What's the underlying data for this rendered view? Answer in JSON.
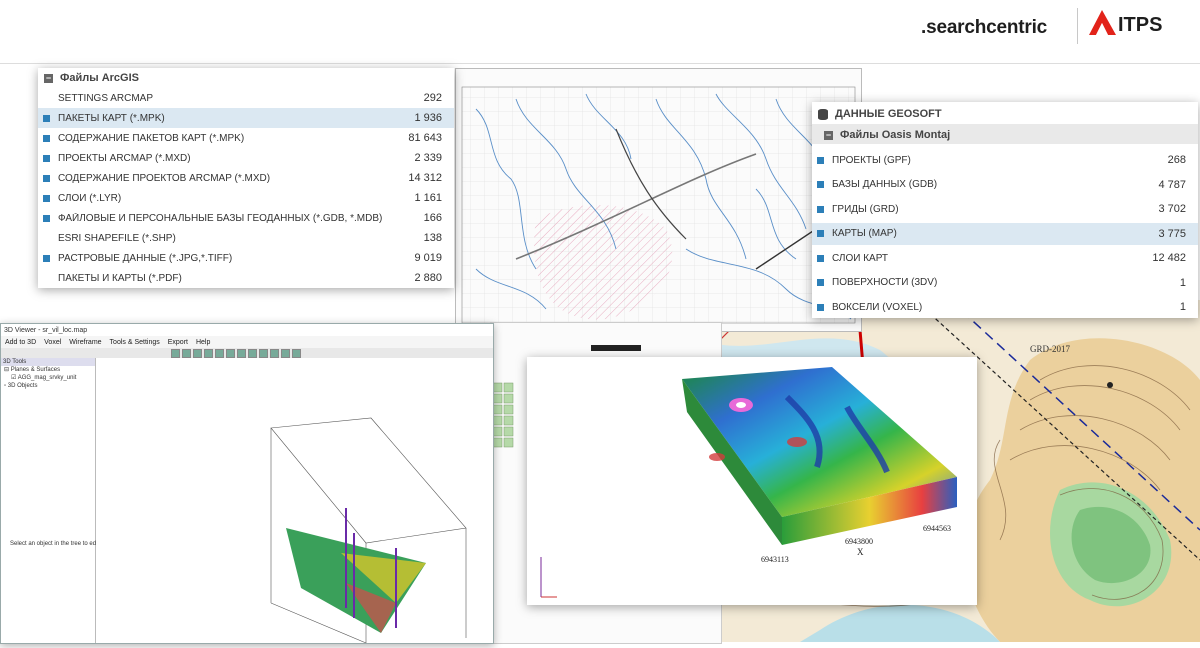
{
  "brand": {
    "left_logo": ".searchcentric",
    "right_logo": "ITPS"
  },
  "arcgis": {
    "title": "Файлы ArcGIS",
    "rows": [
      {
        "label": "SETTINGS ARCMAP",
        "value": "292",
        "icon": false,
        "selected": false
      },
      {
        "label": "ПАКЕТЫ КАРТ (*.MPK)",
        "value": "1 936",
        "icon": true,
        "selected": true
      },
      {
        "label": "СОДЕРЖАНИЕ ПАКЕТОВ КАРТ (*.MPK)",
        "value": "81 643",
        "icon": true,
        "selected": false
      },
      {
        "label": "ПРОЕКТЫ ARCMAP (*.MXD)",
        "value": "2 339",
        "icon": true,
        "selected": false
      },
      {
        "label": "СОДЕРЖАНИЕ ПРОЕКТОВ ARCMAP (*.MXD)",
        "value": "14 312",
        "icon": true,
        "selected": false
      },
      {
        "label": "СЛОИ (*.LYR)",
        "value": "1 161",
        "icon": true,
        "selected": false
      },
      {
        "label": "ФАЙЛОВЫЕ И ПЕРСОНАЛЬНЫЕ БАЗЫ ГЕОДАННЫХ (*.GDB, *.MDB)",
        "value": "166",
        "icon": true,
        "selected": false
      },
      {
        "label": "ESRI SHAPEFILE (*.SHP)",
        "value": "138",
        "icon": false,
        "selected": false
      },
      {
        "label": "РАСТРОВЫЕ ДАННЫЕ (*.JPG,*.TIFF)",
        "value": "9 019",
        "icon": true,
        "selected": false
      },
      {
        "label": "ПАКЕТЫ И КАРТЫ (*.PDF)",
        "value": "2 880",
        "icon": false,
        "selected": false
      }
    ]
  },
  "geosoft": {
    "header": "ДАННЫЕ GEOSOFT",
    "title": "Файлы Oasis Montaj",
    "rows": [
      {
        "label": "ПРОЕКТЫ (GPF)",
        "value": "268",
        "selected": false
      },
      {
        "label": "БАЗЫ ДАННЫХ (GDB)",
        "value": "4 787",
        "selected": false
      },
      {
        "label": "ГРИДЫ (GRD)",
        "value": "3 702",
        "selected": false
      },
      {
        "label": "КАРТЫ (MAP)",
        "value": "3 775",
        "selected": true
      },
      {
        "label": "СЛОИ КАРТ",
        "value": "12 482",
        "selected": false
      },
      {
        "label": "ПОВЕРХНОСТИ (3DV)",
        "value": "1",
        "selected": false
      },
      {
        "label": "ВОКСЕЛИ (VOXEL)",
        "value": "1",
        "selected": false
      }
    ]
  },
  "viewer": {
    "title": "3D Viewer - sr_vil_loc.map",
    "menu": [
      "Add to 3D",
      "Voxel",
      "Wireframe",
      "Tools & Settings",
      "Export",
      "Help"
    ],
    "tree_header": "3D Tools",
    "tree_items": [
      "Planes & Surfaces",
      "AGG_mag_srvky_unit",
      "3D Objects"
    ],
    "hint": "Select an object in the tree to edit its properties or select multiple visible objects to adjust their clipping ranges at the same time."
  },
  "block": {
    "x_labels": [
      "6943113",
      "6943800",
      "6944563"
    ],
    "x_axis": "X",
    "y_label": "GRD-2017"
  }
}
